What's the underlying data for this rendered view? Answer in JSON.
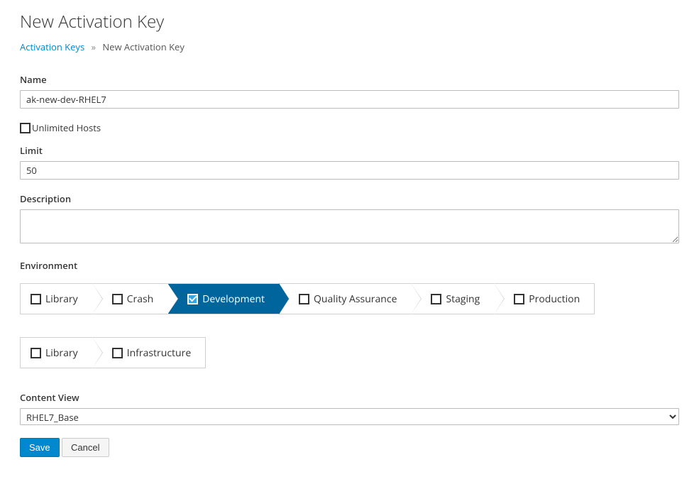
{
  "page": {
    "title": "New Activation Key"
  },
  "breadcrumb": {
    "parent": "Activation Keys",
    "separator": "»",
    "current": "New Activation Key"
  },
  "form": {
    "name_label": "Name",
    "name_value": "ak-new-dev-RHEL7",
    "unlimited_label": "Unlimited Hosts",
    "unlimited_checked": false,
    "limit_label": "Limit",
    "limit_value": "50",
    "description_label": "Description",
    "description_value": "",
    "environment_label": "Environment",
    "content_view_label": "Content View",
    "content_view_value": "RHEL7_Base"
  },
  "environment_paths": [
    {
      "steps": [
        {
          "label": "Library",
          "checked": false,
          "active": false
        },
        {
          "label": "Crash",
          "checked": false,
          "active": false
        },
        {
          "label": "Development",
          "checked": true,
          "active": true
        },
        {
          "label": "Quality Assurance",
          "checked": false,
          "active": false
        },
        {
          "label": "Staging",
          "checked": false,
          "active": false
        },
        {
          "label": "Production",
          "checked": false,
          "active": false
        }
      ]
    },
    {
      "steps": [
        {
          "label": "Library",
          "checked": false,
          "active": false
        },
        {
          "label": "Infrastructure",
          "checked": false,
          "active": false
        }
      ]
    }
  ],
  "buttons": {
    "save": "Save",
    "cancel": "Cancel"
  }
}
